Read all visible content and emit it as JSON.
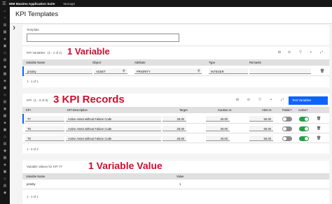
{
  "topbar": {
    "brand": "IBM Maximo Application Suite",
    "manage": "Manage"
  },
  "page": {
    "title": "KPI Templates"
  },
  "template_section": {
    "label": "Template"
  },
  "kpi_variables": {
    "title": "KPI Variables",
    "count": "(1 - 1 of 1)",
    "annotation": "1 Variable",
    "columns": [
      "Variable Name",
      "Object",
      "Attribute",
      "Type",
      "Remarks"
    ],
    "rows": [
      {
        "variable_name": "priority",
        "object": "ASSET",
        "attribute": "PRIORITY",
        "type": "INTEGER",
        "remarks": ""
      }
    ],
    "pager": "1 - 1 of 1"
  },
  "kpi": {
    "title": "KPI",
    "count": "(1 - 3 of 3)",
    "annotation": "3 KPI Records",
    "test_button": "Test Variables",
    "columns": [
      "KPI",
      "KPI Description",
      "Target",
      "Caution At",
      "Alert At",
      "Public?",
      "Active?"
    ],
    "rows": [
      {
        "kpi": "T7",
        "description": "Active Asset without Failure Code",
        "target": "25.00",
        "caution": "40.00",
        "alert": "50.00",
        "public": false,
        "active": true
      },
      {
        "kpi": "T8",
        "description": "Active Asset without Failure Code",
        "target": "25.00",
        "caution": "40.00",
        "alert": "50.00",
        "public": false,
        "active": true
      },
      {
        "kpi": "T9",
        "description": "Active Asset without Failure Code",
        "target": "25.00",
        "caution": "40.00",
        "alert": "50.00",
        "public": false,
        "active": true
      }
    ],
    "pager": "1 - 3 of 3"
  },
  "variable_values": {
    "title": "Variable Values for KPI T7",
    "annotation": "1 Variable Value",
    "columns": [
      "Variable Name",
      "Value"
    ],
    "rows": [
      {
        "variable_name": "priority",
        "value": "1"
      }
    ],
    "pager": "1 - 1 of 1"
  },
  "colors": {
    "accent": "#0f62fe",
    "annotation": "#c8102e",
    "toggle_on": "#24a148",
    "toggle_off": "#8d8d8d"
  },
  "icons": [
    "menu-icon",
    "chevron-right-icon",
    "search-icon",
    "filter-icon",
    "expand-icon",
    "add-icon",
    "trash-icon",
    "download-icon"
  ]
}
